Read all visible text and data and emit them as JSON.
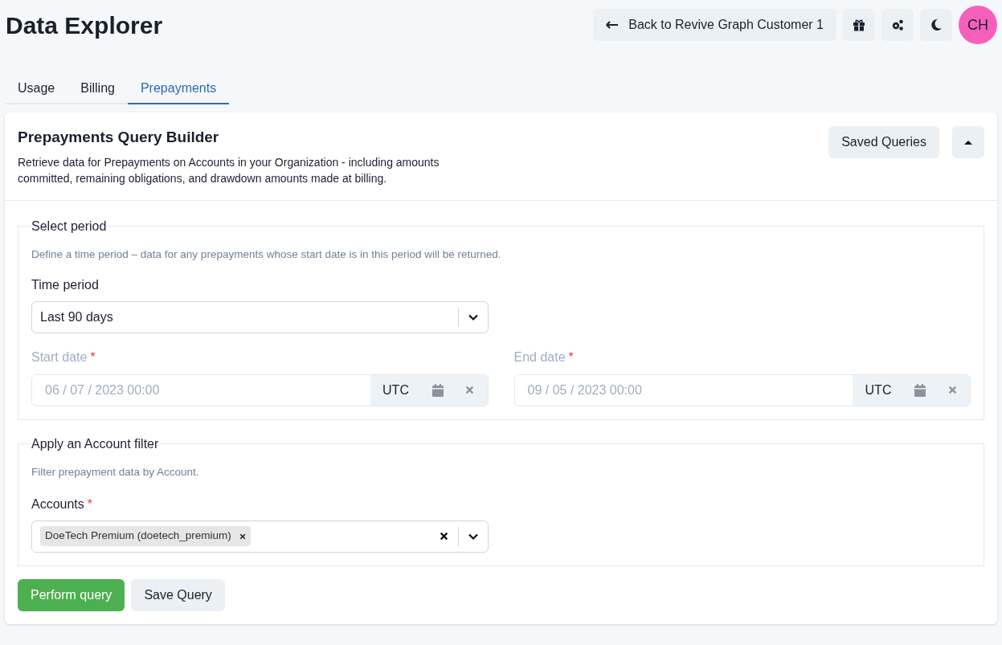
{
  "page": {
    "title": "Data Explorer"
  },
  "header": {
    "back_button": "Back to Revive Graph Customer 1",
    "avatar": "CH"
  },
  "tabs": [
    {
      "label": "Usage",
      "selected": false
    },
    {
      "label": "Billing",
      "selected": false
    },
    {
      "label": "Prepayments",
      "selected": true
    }
  ],
  "card": {
    "title": "Prepayments Query Builder",
    "description": "Retrieve data for Prepayments on Accounts in your Organization - including amounts committed, remaining obligations, and drawdown amounts made at billing.",
    "saved_queries_button": "Saved Queries",
    "expanded": true
  },
  "period_section": {
    "legend": "Select period",
    "help": "Define a time period – data for any prepayments whose start date is in this period will be returned.",
    "time_period": {
      "label": "Time period",
      "value": "Last 90 days"
    },
    "dates": [
      {
        "label": "Start date",
        "required_mark": "*",
        "value": "06 / 07 / 2023 00:00",
        "timezone": "UTC",
        "disabled": true
      },
      {
        "label": "End date",
        "required_mark": "*",
        "value": "09 / 05 / 2023 00:00",
        "timezone": "UTC",
        "disabled": true
      }
    ]
  },
  "account_section": {
    "legend": "Apply an Account filter",
    "help": "Filter prepayment data by Account.",
    "accounts": {
      "label": "Accounts",
      "required_mark": "*",
      "tags": [
        "DoeTech Premium (doetech_premium)"
      ]
    }
  },
  "actions": {
    "primary": "Perform query",
    "secondary": "Save Query"
  }
}
